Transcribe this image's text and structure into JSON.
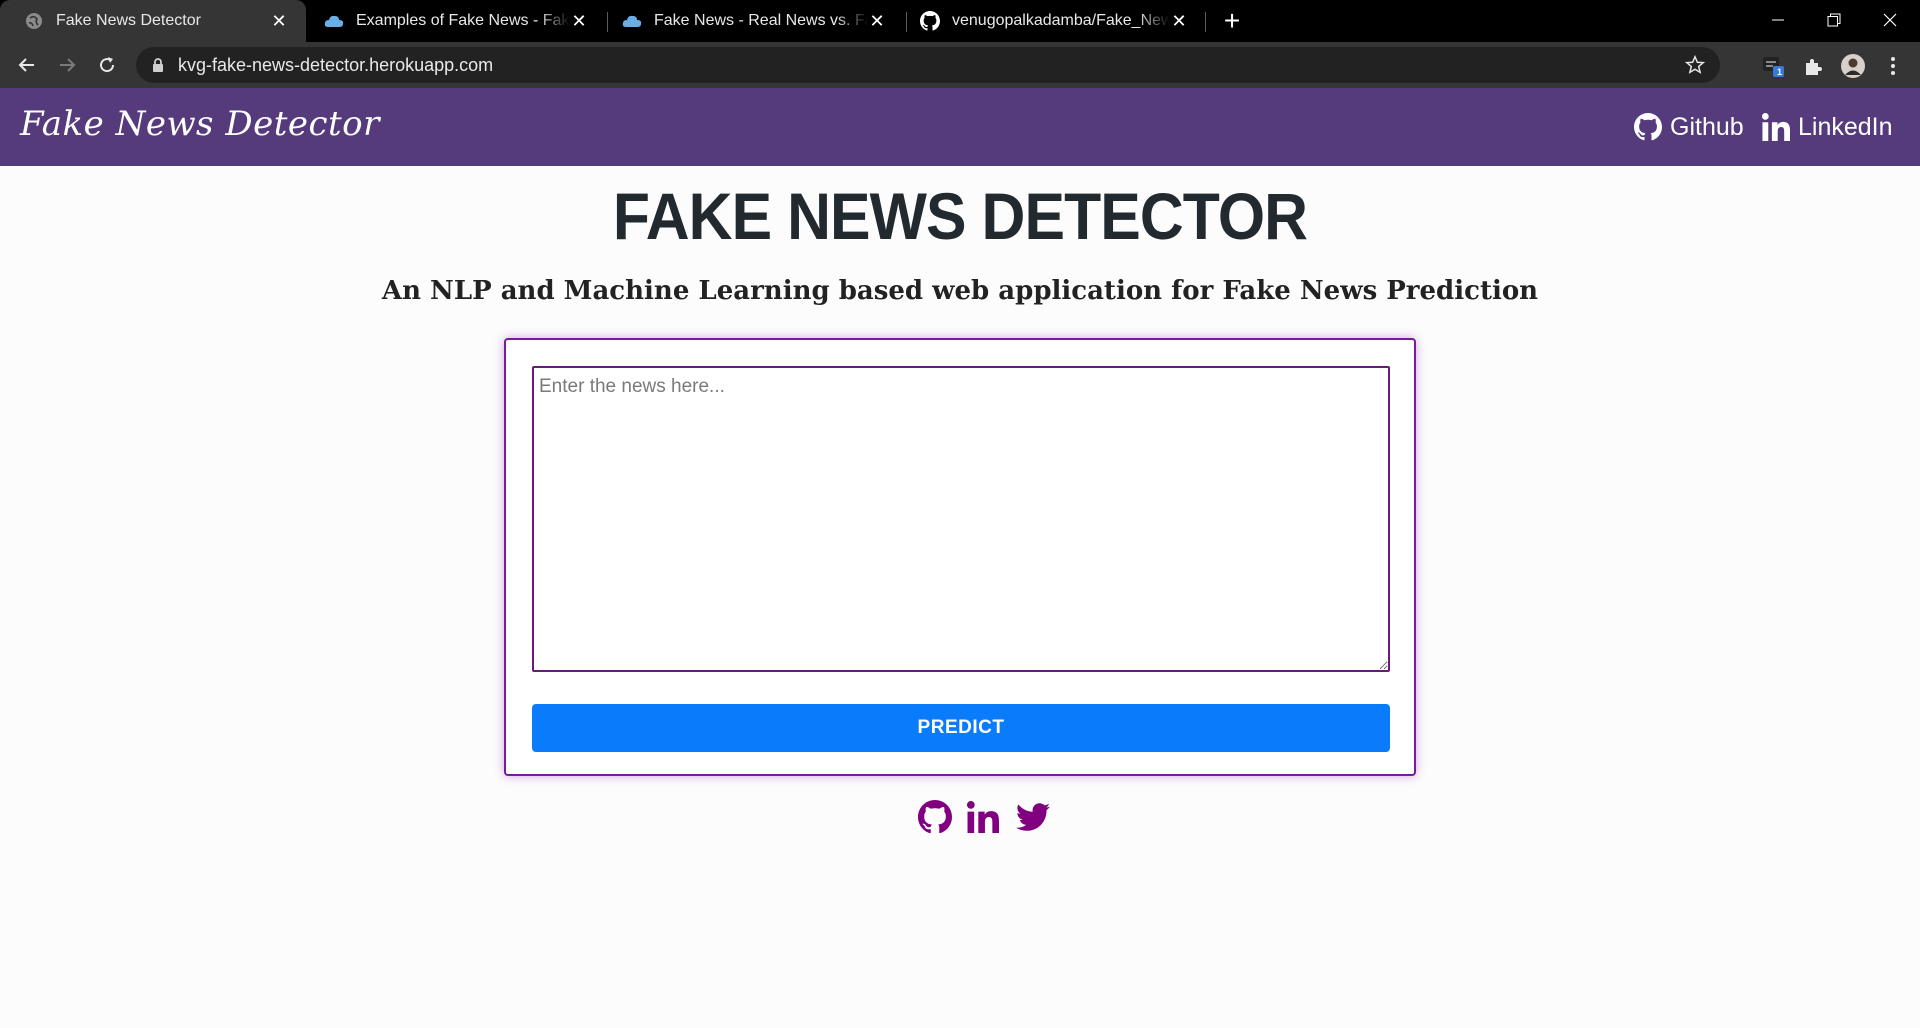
{
  "browser": {
    "tabs": [
      {
        "title": "Fake News Detector",
        "favicon": "globe-icon",
        "active": true
      },
      {
        "title": "Examples of Fake News - Fake News",
        "favicon": "cloud-icon",
        "active": false
      },
      {
        "title": "Fake News - Real News vs. Fake News",
        "favicon": "cloud-icon",
        "active": false
      },
      {
        "title": "venugopalkadamba/Fake_News_Detection",
        "favicon": "github-icon",
        "active": false
      }
    ],
    "new_tab_label": "+",
    "url": "kvg-fake-news-detector.herokuapp.com",
    "extension_badge": "1"
  },
  "navbar": {
    "brand": "Fake News Detector",
    "links": [
      {
        "label": "Github",
        "icon": "github-icon"
      },
      {
        "label": "LinkedIn",
        "icon": "linkedin-icon"
      }
    ]
  },
  "hero": {
    "title": "FAKE NEWS DETECTOR",
    "subtitle": "An NLP and Machine Learning based web application for Fake News Prediction"
  },
  "form": {
    "news_value": "",
    "news_placeholder": "Enter the news here...",
    "predict_label": "PREDICT"
  },
  "footer": {
    "social_icons": [
      "github-icon",
      "linkedin-icon",
      "twitter-icon"
    ]
  },
  "colors": {
    "navbar_bg": "#553b7c",
    "accent_purple": "#800080",
    "button_blue": "#0a7bfa"
  }
}
